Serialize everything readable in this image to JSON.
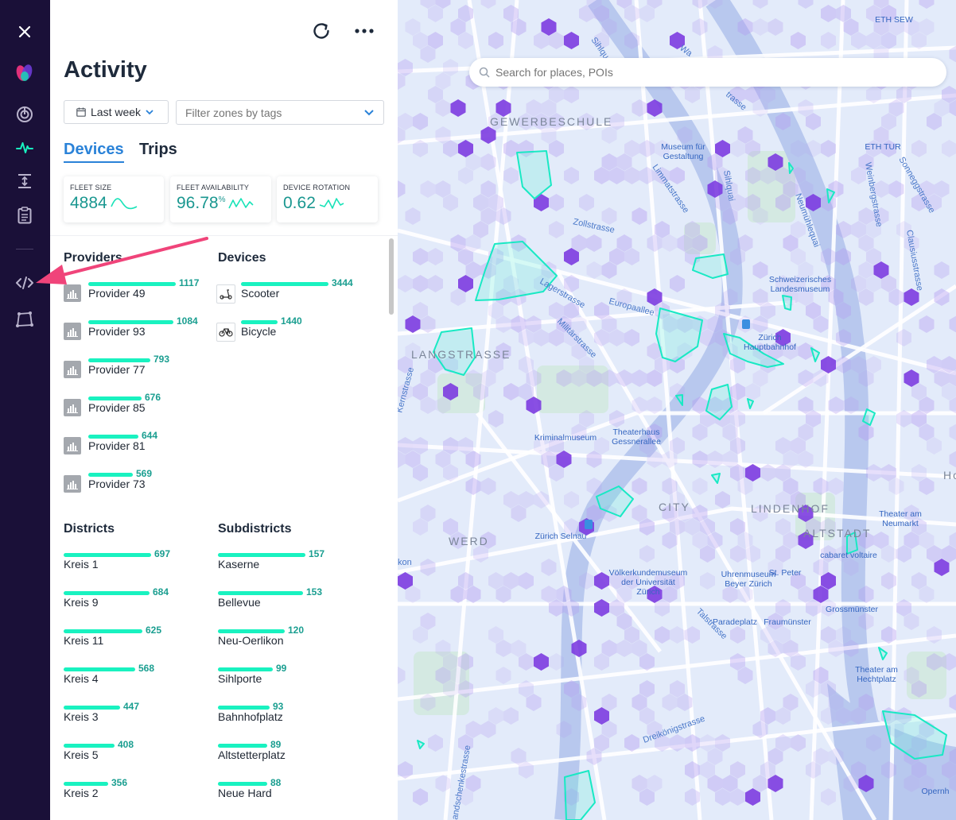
{
  "colors": {
    "rail_bg": "#1a1038",
    "accent_teal": "#19f2c0",
    "value_teal": "#1a9e90",
    "tab_active": "#2a82d8",
    "arrow_pink": "#f0447a"
  },
  "rail": {
    "items": [
      {
        "icon": "close-icon"
      },
      {
        "icon": "brand-logo-icon"
      },
      {
        "icon": "target-icon"
      },
      {
        "icon": "activity-pulse-icon"
      },
      {
        "icon": "vertical-expand-icon"
      },
      {
        "icon": "clipboard-icon"
      },
      {
        "icon": "code-icon"
      },
      {
        "icon": "polygon-icon"
      }
    ]
  },
  "header": {
    "title": "Activity",
    "refresh_icon": "refresh-icon",
    "more_icon": "more-icon"
  },
  "filters": {
    "date_label": "Last week",
    "tag_placeholder": "Filter zones by tags"
  },
  "tabs": [
    {
      "label": "Devices",
      "active": true
    },
    {
      "label": "Trips",
      "active": false
    }
  ],
  "kpis": [
    {
      "label": "FLEET SIZE",
      "value": "4884",
      "suffix": ""
    },
    {
      "label": "FLEET AVAILABILITY",
      "value": "96.78",
      "suffix": "%"
    },
    {
      "label": "DEVICE ROTATION",
      "value": "0.62",
      "suffix": ""
    }
  ],
  "providers": {
    "title": "Providers",
    "items": [
      {
        "name": "Provider 49",
        "value": 1117
      },
      {
        "name": "Provider 93",
        "value": 1084
      },
      {
        "name": "Provider 77",
        "value": 793
      },
      {
        "name": "Provider 85",
        "value": 676
      },
      {
        "name": "Provider 81",
        "value": 644
      },
      {
        "name": "Provider 73",
        "value": 569
      }
    ]
  },
  "devices": {
    "title": "Devices",
    "items": [
      {
        "name": "Scooter",
        "value": 3444,
        "icon": "scooter-icon"
      },
      {
        "name": "Bicycle",
        "value": 1440,
        "icon": "bicycle-icon"
      }
    ]
  },
  "districts": {
    "title": "Districts",
    "items": [
      {
        "name": "Kreis 1",
        "value": 697
      },
      {
        "name": "Kreis 9",
        "value": 684
      },
      {
        "name": "Kreis 11",
        "value": 625
      },
      {
        "name": "Kreis 4",
        "value": 568
      },
      {
        "name": "Kreis 3",
        "value": 447
      },
      {
        "name": "Kreis 5",
        "value": 408
      },
      {
        "name": "Kreis 2",
        "value": 356
      }
    ]
  },
  "subdistricts": {
    "title": "Subdistricts",
    "items": [
      {
        "name": "Kaserne",
        "value": 157
      },
      {
        "name": "Bellevue",
        "value": 153
      },
      {
        "name": "Neu-Oerlikon",
        "value": 120
      },
      {
        "name": "Sihlporte",
        "value": 99
      },
      {
        "name": "Bahnhofplatz",
        "value": 93
      },
      {
        "name": "Altstetterplatz",
        "value": 89
      },
      {
        "name": "Neue Hard",
        "value": 88
      }
    ]
  },
  "map": {
    "search_placeholder": "Search for places, POIs",
    "labels": [
      {
        "text": "GEWERBESCHULE",
        "kind": "district"
      },
      {
        "text": "LANGSTRASSE",
        "kind": "district"
      },
      {
        "text": "CITY",
        "kind": "district"
      },
      {
        "text": "LINDENHOF",
        "kind": "district"
      },
      {
        "text": "ALTSTADT",
        "kind": "district"
      },
      {
        "text": "WERD",
        "kind": "district"
      },
      {
        "text": "ETH SEW",
        "kind": "poi"
      },
      {
        "text": "ETH TUR",
        "kind": "poi"
      },
      {
        "text": "Museum für\nGestaltung",
        "kind": "poi"
      },
      {
        "text": "Schweizerisches\nLandesmuseum",
        "kind": "poi"
      },
      {
        "text": "Zürich\nHauptbahnhof",
        "kind": "poi"
      },
      {
        "text": "Kriminalmuseum",
        "kind": "poi"
      },
      {
        "text": "Theaterhaus\nGessnerallee",
        "kind": "poi"
      },
      {
        "text": "Zürich Selnau",
        "kind": "poi"
      },
      {
        "text": "Völkerkundemuseum\nder Universität\nZürich",
        "kind": "poi"
      },
      {
        "text": "Uhrenmuseum\nBeyer Zürich",
        "kind": "poi"
      },
      {
        "text": "St. Peter",
        "kind": "poi"
      },
      {
        "text": "Theater am\nNeumarkt",
        "kind": "poi"
      },
      {
        "text": "cabaret voltaire",
        "kind": "poi"
      },
      {
        "text": "Grossmünster",
        "kind": "poi"
      },
      {
        "text": "Paradeplatz",
        "kind": "poi"
      },
      {
        "text": "Fraumünster",
        "kind": "poi"
      },
      {
        "text": "Theater am\nHechtplatz",
        "kind": "poi"
      },
      {
        "text": "Opernh",
        "kind": "poi"
      },
      {
        "text": "Zollstrasse",
        "kind": "street"
      },
      {
        "text": "Lagerstrasse",
        "kind": "street"
      },
      {
        "text": "Europaallee",
        "kind": "street"
      },
      {
        "text": "Militärstrasse",
        "kind": "street"
      },
      {
        "text": "Limmatstrasse",
        "kind": "street"
      },
      {
        "text": "Sihlquai",
        "kind": "street"
      },
      {
        "text": "Neumühlequai",
        "kind": "street"
      },
      {
        "text": "Weinbergstrasse",
        "kind": "street"
      },
      {
        "text": "Sonneggstrasse",
        "kind": "street"
      },
      {
        "text": "Clausiusstrasse",
        "kind": "street"
      },
      {
        "text": "Talstrasse",
        "kind": "street"
      },
      {
        "text": "Dreikönigstrasse",
        "kind": "street"
      },
      {
        "text": "Kernstrasse",
        "kind": "street"
      },
      {
        "text": "andschenkestrasse",
        "kind": "street"
      },
      {
        "text": "Wa",
        "kind": "street"
      },
      {
        "text": "Sihlqu",
        "kind": "street"
      },
      {
        "text": "trasse",
        "kind": "street"
      },
      {
        "text": "Ho",
        "kind": "poi"
      },
      {
        "text": "kon",
        "kind": "street"
      }
    ]
  }
}
